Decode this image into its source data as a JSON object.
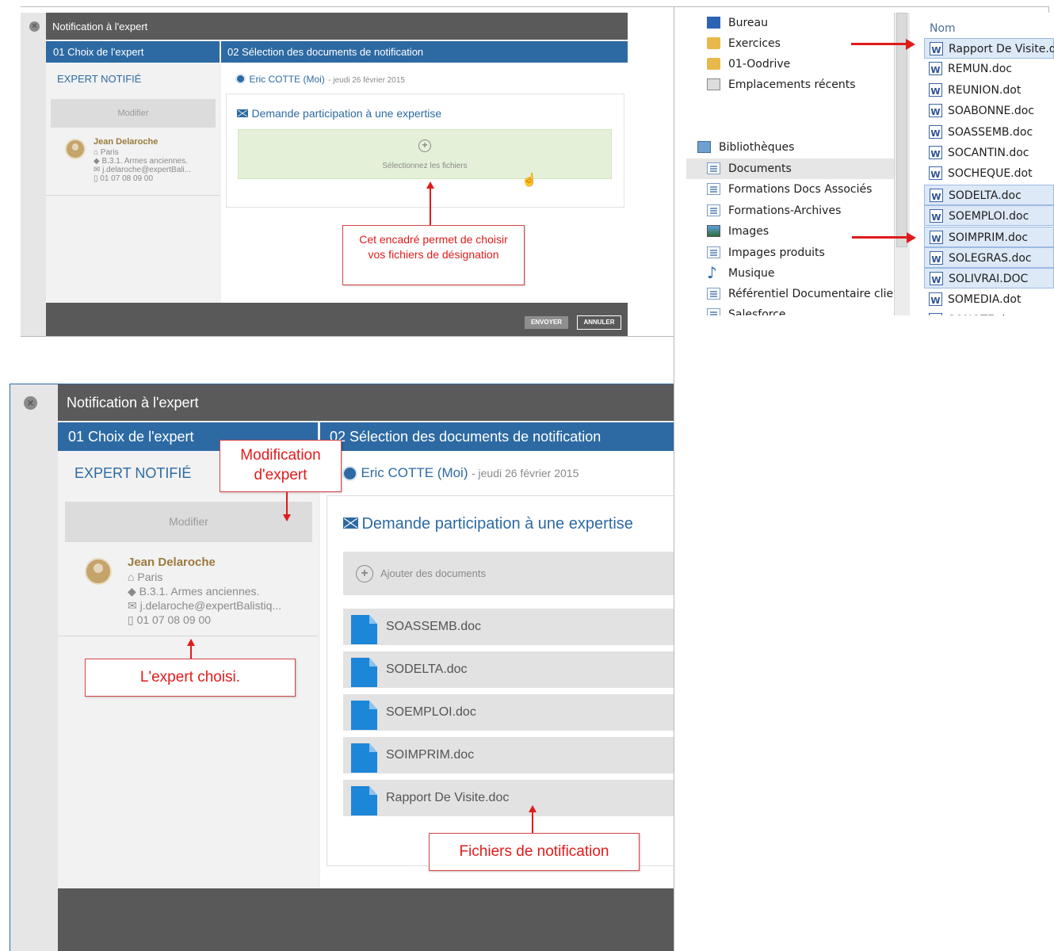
{
  "small_dialog": {
    "title": "Notification à l'expert",
    "close_glyph": "×",
    "col1_header": "01 Choix de l'expert",
    "col2_header": "02 Sélection des documents de notification",
    "expert_section_title": "EXPERT NOTIFIÉ",
    "modify_button": "Modifier",
    "expert": {
      "name": "Jean Delaroche",
      "city": "Paris",
      "speciality": "B.3.1. Armes anciennes.",
      "email": "j.delaroche@expertBali...",
      "phone": "01 07 08 09 00"
    },
    "sender": "Eric COTTE (Moi)",
    "date": "- jeudi 26 février 2015",
    "request_title": "Demande participation à une expertise",
    "select_files": "Sélectionnez les fichiers",
    "plus_glyph": "+",
    "send_button": "ENVOYER",
    "cancel_button": "ANNULER",
    "callout": "Cet encadré permet de choisir vos fichiers de désignation"
  },
  "explorer": {
    "nav_items": [
      {
        "label": "Bureau",
        "icon": "desktop-icon"
      },
      {
        "label": "Exercices",
        "icon": "folder-icon"
      },
      {
        "label": "01-Oodrive",
        "icon": "folder-icon"
      },
      {
        "label": "Emplacements récents",
        "icon": "recent-places-icon"
      },
      {
        "label": "Bibliothèques",
        "icon": "library-icon"
      },
      {
        "label": "Documents",
        "icon": "documents-icon"
      },
      {
        "label": "Formations Docs Associés",
        "icon": "library-icon"
      },
      {
        "label": "Formations-Archives",
        "icon": "library-icon"
      },
      {
        "label": "Images",
        "icon": "pictures-icon"
      },
      {
        "label": "Impages produits",
        "icon": "library-icon"
      },
      {
        "label": "Musique",
        "icon": "music-icon"
      },
      {
        "label": "Référentiel Documentaire client",
        "icon": "library-icon"
      },
      {
        "label": "Salesforce",
        "icon": "library-icon"
      }
    ],
    "column_header": "Nom",
    "files": [
      {
        "name": "Rapport De Visite.doc",
        "selected": true
      },
      {
        "name": "REMUN.doc",
        "selected": false
      },
      {
        "name": "REUNION.dot",
        "selected": false
      },
      {
        "name": "SOABONNE.doc",
        "selected": false
      },
      {
        "name": "SOASSEMB.doc",
        "selected": false
      },
      {
        "name": "SOCANTIN.doc",
        "selected": false
      },
      {
        "name": "SOCHEQUE.dot",
        "selected": false
      },
      {
        "name": "SODELTA.doc",
        "selected": true
      },
      {
        "name": "SOEMPLOI.doc",
        "selected": true
      },
      {
        "name": "SOIMPRIM.doc",
        "selected": true
      },
      {
        "name": "SOLEGRAS.doc",
        "selected": true
      },
      {
        "name": "SOLIVRAI.DOC",
        "selected": true
      },
      {
        "name": "SOMEDIA.dot",
        "selected": false
      },
      {
        "name": "SONOTE.doc",
        "selected": false
      }
    ]
  },
  "large_dialog": {
    "title": "Notification à l'expert",
    "close_glyph": "×",
    "col1_header": "01 Choix de l'expert",
    "col2_header": "02 Sélection des documents de notification",
    "expert_section_title": "EXPERT NOTIFIÉ",
    "modify_button": "Modifier",
    "expert": {
      "name": "Jean Delaroche",
      "city": "Paris",
      "speciality": "B.3.1. Armes anciennes.",
      "email": "j.delaroche@expertBalistiq...",
      "phone": "01 07 08 09 00"
    },
    "sender": "Eric COTTE (Moi)",
    "date": "- jeudi 26 février 2015",
    "request_title": "Demande participation à une expertise",
    "add_documents": "Ajouter des documents",
    "plus_glyph": "+",
    "documents": [
      "SOASSEMB.doc",
      "SODELTA.doc",
      "SOEMPLOI.doc",
      "SOIMPRIM.doc",
      "Rapport De Visite.doc"
    ],
    "callout_modify": "Modification d'expert",
    "callout_expert": "L'expert choisi.",
    "callout_files": "Fichiers de notification"
  },
  "colors": {
    "header_blue": "#2d6aa3",
    "title_grey": "#5a5a5a",
    "callout_red": "#e01b1b",
    "expert_gold": "#9a7a3c",
    "select_green": "#e4f0d8",
    "file_blue": "#1c86d9"
  }
}
